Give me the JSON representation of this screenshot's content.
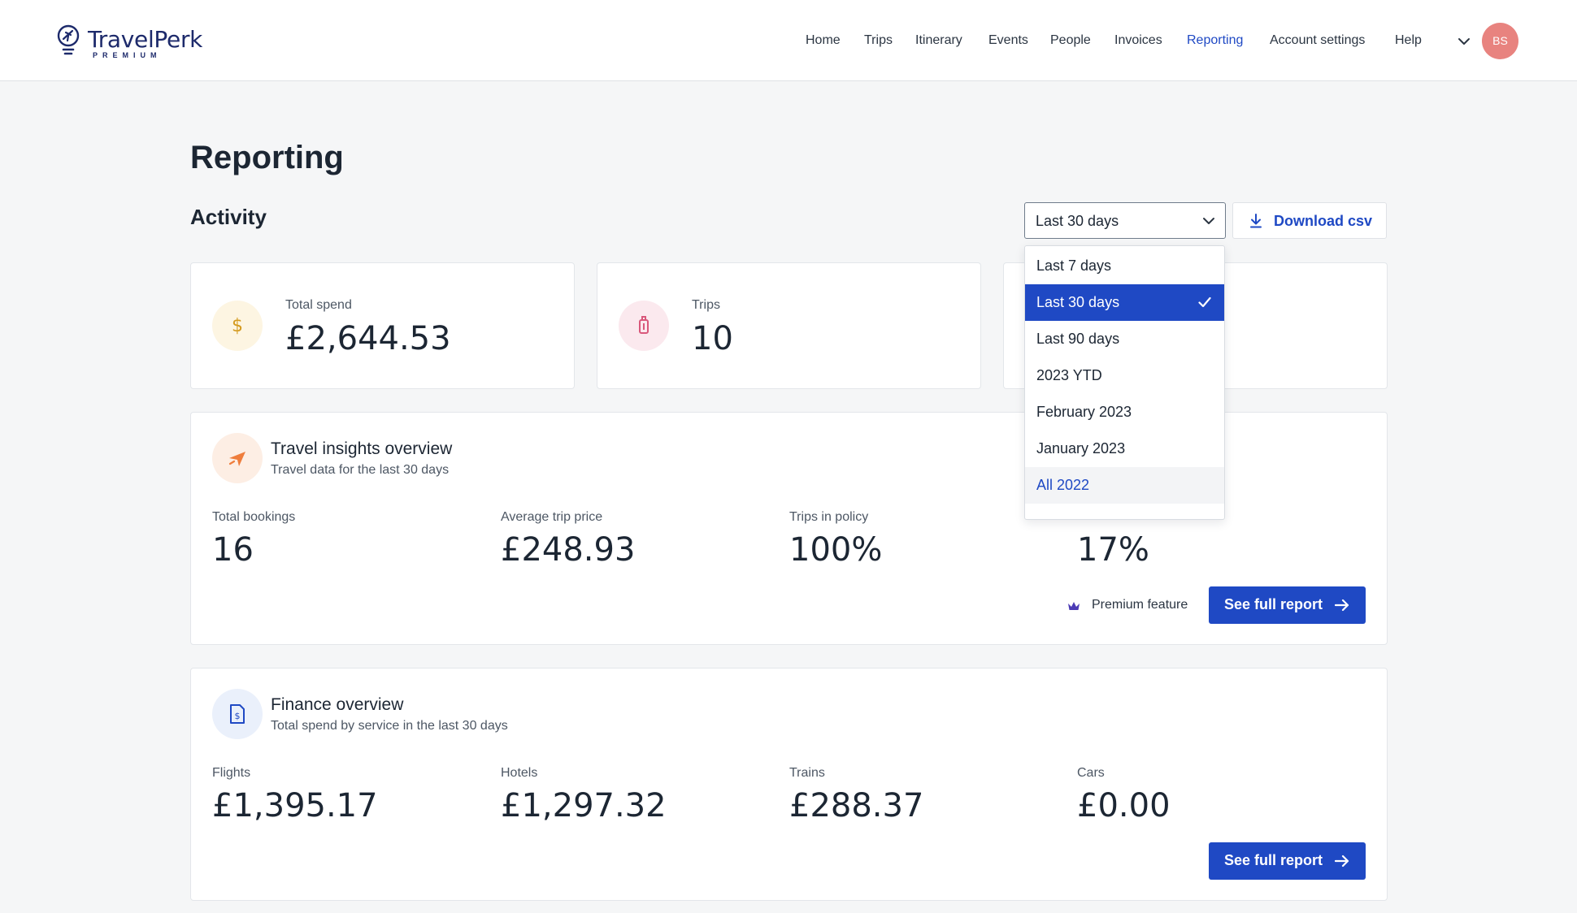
{
  "header": {
    "logo_name": "TravelPerk",
    "logo_sub": "PREMIUM",
    "nav": [
      {
        "label": "Home",
        "active": false
      },
      {
        "label": "Trips",
        "active": false
      },
      {
        "label": "Itinerary",
        "active": false
      },
      {
        "label": "Events",
        "active": false
      },
      {
        "label": "People",
        "active": false
      },
      {
        "label": "Invoices",
        "active": false
      },
      {
        "label": "Reporting",
        "active": true
      },
      {
        "label": "Account settings",
        "active": false
      },
      {
        "label": "Help",
        "active": false
      }
    ],
    "avatar_initials": "BS"
  },
  "page": {
    "title": "Reporting",
    "section": "Activity"
  },
  "controls": {
    "period_selected": "Last 30 days",
    "download_label": "Download csv"
  },
  "dropdown": {
    "options": [
      {
        "label": "Last 7 days",
        "state": "default"
      },
      {
        "label": "Last 30 days",
        "state": "selected"
      },
      {
        "label": "Last 90 days",
        "state": "default"
      },
      {
        "label": "2023 YTD",
        "state": "default"
      },
      {
        "label": "February 2023",
        "state": "default"
      },
      {
        "label": "January 2023",
        "state": "default"
      },
      {
        "label": "All 2022",
        "state": "hover"
      }
    ]
  },
  "summary": {
    "total_spend": {
      "label": "Total spend",
      "value": "£2,644.53",
      "icon": "dollar-icon"
    },
    "trips": {
      "label": "Trips",
      "value": "10",
      "icon": "luggage-icon"
    }
  },
  "travel_insights": {
    "title": "Travel insights overview",
    "subtitle": "Travel data for the last 30 days",
    "icon": "plane-icon",
    "stats": [
      {
        "label": "Total bookings",
        "value": "16"
      },
      {
        "label": "Average trip price",
        "value": "£248.93"
      },
      {
        "label": "Trips in policy",
        "value": "100%"
      },
      {
        "label": "",
        "value": "17%"
      }
    ],
    "premium_label": "Premium feature",
    "cta": "See full report"
  },
  "finance": {
    "title": "Finance overview",
    "subtitle": "Total spend by service in the last 30 days",
    "icon": "invoice-icon",
    "stats": [
      {
        "label": "Flights",
        "value": "£1,395.17"
      },
      {
        "label": "Hotels",
        "value": "£1,297.32"
      },
      {
        "label": "Trains",
        "value": "£288.37"
      },
      {
        "label": "Cars",
        "value": "£0.00"
      }
    ],
    "cta": "See full report"
  },
  "colors": {
    "accent": "#1f49c4",
    "avatar": "#e8837f",
    "spend_icon_bg": "#fdf5e2",
    "trips_icon_bg": "#fbe9ee",
    "travel_icon_bg": "#fdeee4",
    "finance_icon_bg": "#eaf0fb"
  }
}
